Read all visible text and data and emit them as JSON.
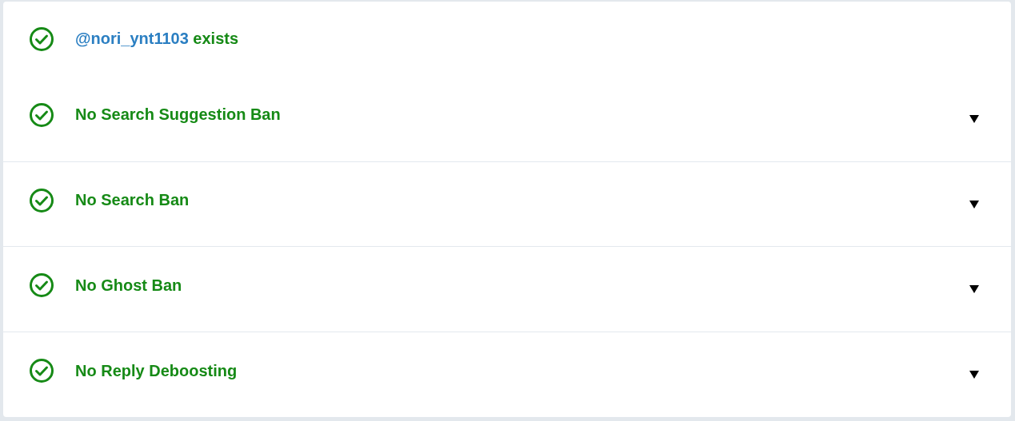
{
  "account": {
    "handle": "@nori_ynt1103",
    "text": "exists",
    "passed": true
  },
  "checks": [
    {
      "label": "No Search Suggestion Ban",
      "passed": true,
      "expanded": false
    },
    {
      "label": "No Search Ban",
      "passed": true,
      "expanded": false
    },
    {
      "label": "No Ghost Ban",
      "passed": true,
      "expanded": false
    },
    {
      "label": "No Reply Deboosting",
      "passed": true,
      "expanded": false
    }
  ]
}
